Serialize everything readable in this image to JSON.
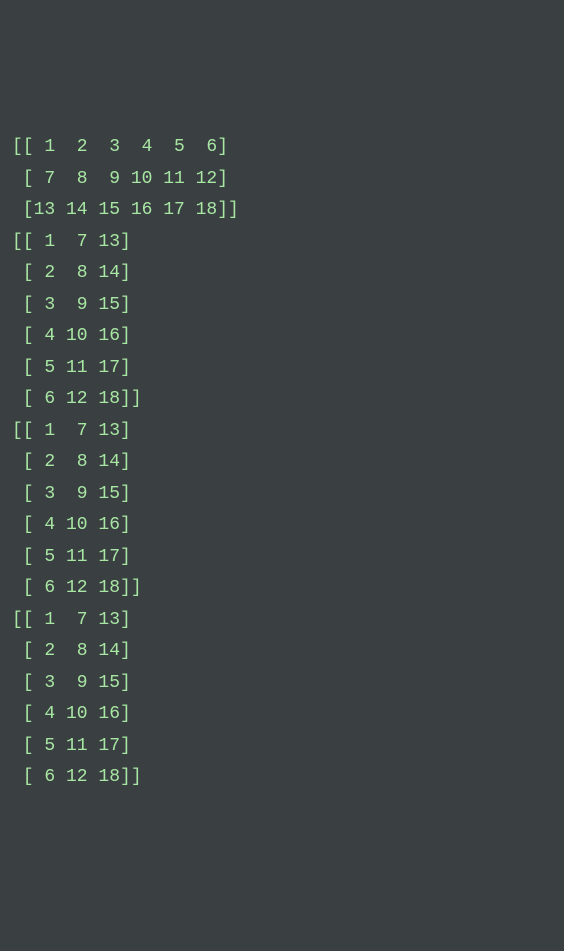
{
  "output": {
    "lines": [
      "[[ 1  2  3  4  5  6]",
      " [ 7  8  9 10 11 12]",
      " [13 14 15 16 17 18]]",
      "[[ 1  7 13]",
      " [ 2  8 14]",
      " [ 3  9 15]",
      " [ 4 10 16]",
      " [ 5 11 17]",
      " [ 6 12 18]]",
      "[[ 1  7 13]",
      " [ 2  8 14]",
      " [ 3  9 15]",
      " [ 4 10 16]",
      " [ 5 11 17]",
      " [ 6 12 18]]",
      "[[ 1  7 13]",
      " [ 2  8 14]",
      " [ 3  9 15]",
      " [ 4 10 16]",
      " [ 5 11 17]",
      " [ 6 12 18]]"
    ]
  }
}
